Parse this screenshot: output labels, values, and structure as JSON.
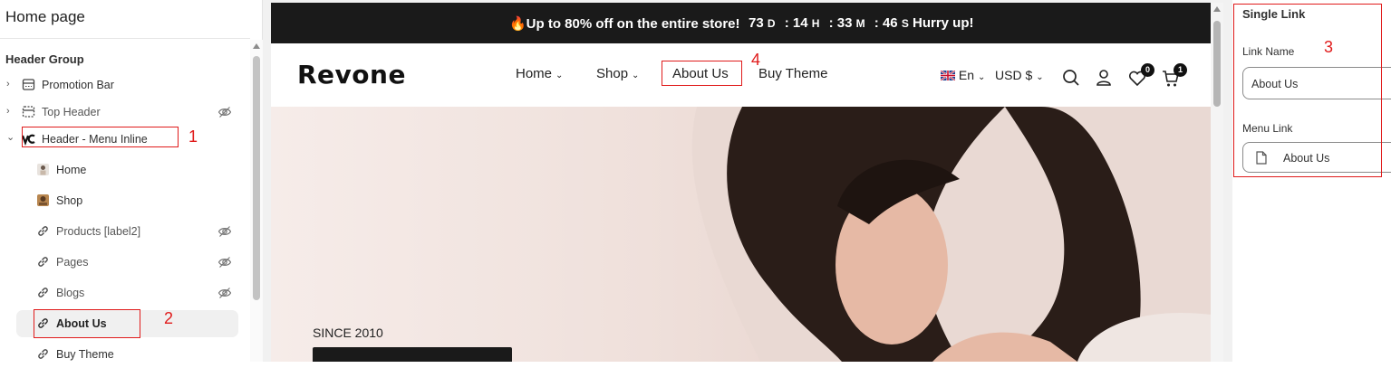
{
  "left_panel": {
    "title": "Home page",
    "group_title": "Header Group",
    "tree": [
      {
        "label": "Promotion Bar",
        "icon": "promotion-bar-icon",
        "hidden": false
      },
      {
        "label": "Top Header",
        "icon": "top-header-icon",
        "hidden": true
      },
      {
        "label": "Header - Menu Inline",
        "icon": "header-menu-icon",
        "hidden": false
      }
    ],
    "children": [
      {
        "label": "Home",
        "icon": "home-image-icon",
        "hidden": false
      },
      {
        "label": "Shop",
        "icon": "shop-image-icon",
        "hidden": false
      },
      {
        "label": "Products [label2]",
        "icon": "link-icon",
        "hidden": true
      },
      {
        "label": "Pages",
        "icon": "link-icon",
        "hidden": true
      },
      {
        "label": "Blogs",
        "icon": "link-icon",
        "hidden": true
      },
      {
        "label": "About Us",
        "icon": "link-icon",
        "hidden": false,
        "selected": true
      },
      {
        "label": "Buy Theme",
        "icon": "link-icon",
        "hidden": false
      }
    ]
  },
  "preview": {
    "promo": {
      "text": "🔥Up to 80% off on the entire store!",
      "days": "73",
      "days_unit": "D",
      "hours": "14",
      "hours_unit": "H",
      "minutes": "33",
      "minutes_unit": "M",
      "seconds": "46",
      "seconds_unit": "S",
      "hurry": "Hurry up!"
    },
    "logo": "Revone",
    "nav": [
      {
        "label": "Home",
        "has_caret": true
      },
      {
        "label": "Shop",
        "has_caret": true
      },
      {
        "label": "About Us",
        "has_caret": false
      },
      {
        "label": "Buy Theme",
        "has_caret": false
      }
    ],
    "language": "En",
    "currency": "USD $",
    "wishlist_count": "0",
    "cart_count": "1",
    "hero_since": "SINCE 2010"
  },
  "right_panel": {
    "title": "Single Link",
    "link_name_label": "Link Name",
    "link_name_value": "About Us",
    "menu_link_label": "Menu Link",
    "menu_link_value": "About Us"
  },
  "annotations": [
    "1",
    "2",
    "3",
    "4"
  ],
  "colors": {
    "annotation_red": "#e01b1b",
    "promo_bg": "#1a1a1a",
    "selected_row_bg": "#f0f0f0"
  }
}
